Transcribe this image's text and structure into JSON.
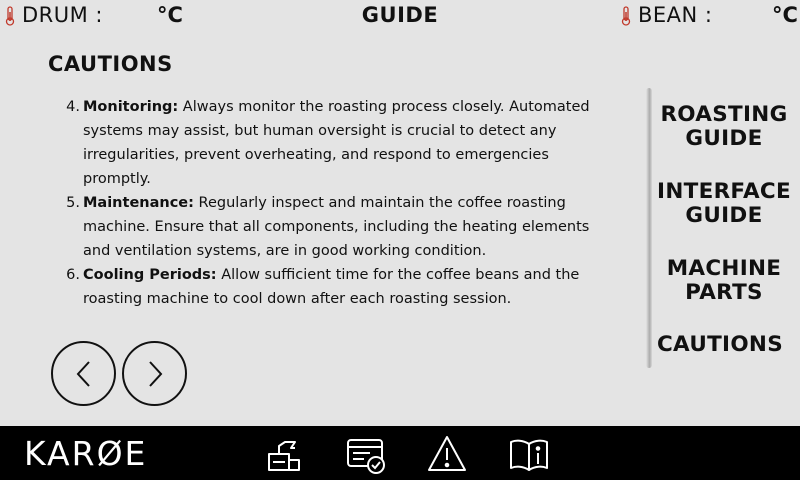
{
  "header": {
    "drum_label": "DRUM :",
    "drum_unit": "°C",
    "title": "GUIDE",
    "bean_label": "BEAN :",
    "bean_unit": "°C"
  },
  "section": {
    "heading": "CAUTIONS"
  },
  "cautions": [
    {
      "number": "4.",
      "title": "Monitoring:",
      "text": " Always monitor the roasting process closely. Automated systems may assist, but human oversight is crucial to detect any irregularities, prevent overheating, and respond to emergencies promptly."
    },
    {
      "number": "5.",
      "title": "Maintenance:",
      "text": " Regularly inspect and maintain the coffee roasting machine. Ensure that all components, including the heating elements and ventilation systems, are in good working condition."
    },
    {
      "number": "6.",
      "title": "Cooling Periods:",
      "text": " Allow sufficient time for the coffee beans and the roasting machine to cool down after each roasting session."
    }
  ],
  "side_menu": {
    "roasting_guide": [
      "ROASTING",
      "GUIDE"
    ],
    "interface_guide": [
      "INTERFACE",
      "GUIDE"
    ],
    "machine_parts": [
      "MACHINE",
      "PARTS"
    ],
    "cautions": "CAUTIONS"
  },
  "footer": {
    "logo": "KARØE"
  },
  "icons": {
    "thermometer": "thermometer-icon",
    "prev": "chevron-left-icon",
    "next": "chevron-right-icon",
    "roast": "roaster-icon",
    "profile": "profile-card-icon",
    "warning": "warning-icon",
    "guide": "book-info-icon"
  },
  "colors": {
    "background": "#e4e4e4",
    "thermometer": "#c0392b",
    "bottom_bar": "#000000"
  }
}
